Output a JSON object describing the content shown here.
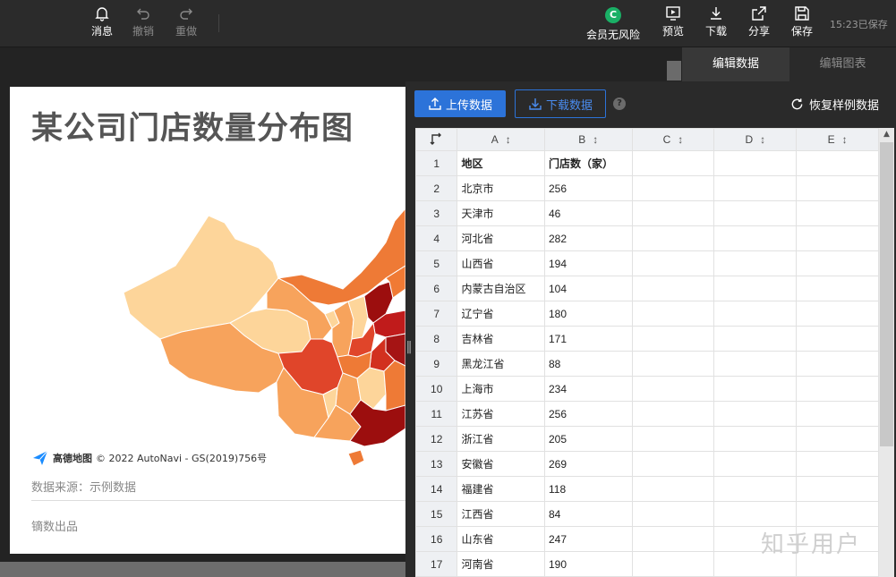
{
  "toolbar": {
    "left": [
      {
        "label": "消息",
        "icon": "bell-icon",
        "enabled": true
      },
      {
        "label": "撤销",
        "icon": "undo-icon",
        "enabled": false
      },
      {
        "label": "重做",
        "icon": "redo-icon",
        "enabled": false
      }
    ],
    "right": [
      {
        "label": "会员无风险",
        "icon": "member-icon"
      },
      {
        "label": "预览",
        "icon": "preview-icon"
      },
      {
        "label": "下载",
        "icon": "download-icon"
      },
      {
        "label": "分享",
        "icon": "share-icon"
      },
      {
        "label": "保存",
        "icon": "save-icon"
      }
    ],
    "member_badge": "C",
    "save_status": "15:23已保存"
  },
  "tabs": [
    {
      "label": "编辑数据",
      "active": true
    },
    {
      "label": "编辑图表",
      "active": false
    }
  ],
  "canvas": {
    "title": "某公司门店数量分布图",
    "attribution_logo": "高德地图",
    "attribution_text": "© 2022 AutoNavi - GS(2019)756号",
    "source": "数据来源：示例数据",
    "brand": "镝数出品"
  },
  "data_panel": {
    "upload_label": "上传数据",
    "download_label": "下载数据",
    "help": "?",
    "restore_label": "恢复样例数据",
    "column_letters": [
      "A",
      "B",
      "C",
      "D",
      "E"
    ],
    "rows": [
      [
        "地区",
        "门店数（家）"
      ],
      [
        "北京市",
        "256"
      ],
      [
        "天津市",
        "46"
      ],
      [
        "河北省",
        "282"
      ],
      [
        "山西省",
        "194"
      ],
      [
        "内蒙古自治区",
        "104"
      ],
      [
        "辽宁省",
        "180"
      ],
      [
        "吉林省",
        "171"
      ],
      [
        "黑龙江省",
        "88"
      ],
      [
        "上海市",
        "234"
      ],
      [
        "江苏省",
        "256"
      ],
      [
        "浙江省",
        "205"
      ],
      [
        "安徽省",
        "269"
      ],
      [
        "福建省",
        "118"
      ],
      [
        "江西省",
        "84"
      ],
      [
        "山东省",
        "247"
      ],
      [
        "河南省",
        "190"
      ]
    ]
  },
  "colors": {
    "accent": "#2c73d9",
    "member_green": "#1ab066",
    "map_light": "#fdd59a",
    "map_mid": "#f7a35c",
    "map_orange": "#ee7a36",
    "map_red": "#e0452a",
    "map_dark": "#9c0e0e"
  },
  "watermark": "知乎用户"
}
